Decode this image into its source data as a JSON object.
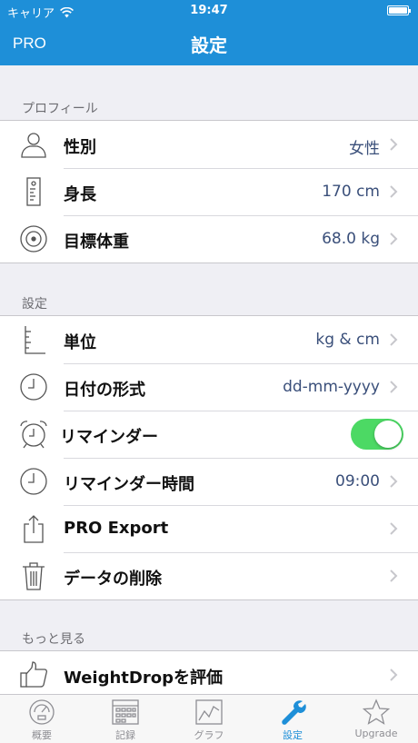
{
  "status_bar": {
    "carrier": "キャリア",
    "time": "19:47"
  },
  "nav": {
    "left_button": "PRO",
    "title": "設定"
  },
  "sections": [
    {
      "header": "プロフィール",
      "rows": [
        {
          "icon": "person-icon",
          "label": "性別",
          "value": "女性"
        },
        {
          "icon": "height-icon",
          "label": "身長",
          "value": "170 cm"
        },
        {
          "icon": "target-icon",
          "label": "目標体重",
          "value": "68.0 kg"
        }
      ]
    },
    {
      "header": "設定",
      "rows": [
        {
          "icon": "ruler-icon",
          "label": "単位",
          "value": "kg & cm"
        },
        {
          "icon": "clock-icon",
          "label": "日付の形式",
          "value": "dd-mm-yyyy"
        },
        {
          "icon": "alarm-clock-icon",
          "label": "リマインダー",
          "toggle_on": true
        },
        {
          "icon": "clock-icon",
          "label": "リマインダー時間",
          "value": "09:00"
        },
        {
          "icon": "share-icon",
          "label": "PRO Export",
          "value": ""
        },
        {
          "icon": "trash-icon",
          "label": "データの削除",
          "value": ""
        }
      ]
    },
    {
      "header": "もっと見る",
      "rows": [
        {
          "icon": "thumbs-up-icon",
          "label": "WeightDropを評価",
          "value": ""
        }
      ]
    }
  ],
  "tabs": [
    {
      "icon": "gauge-icon",
      "label": "概要",
      "active": false
    },
    {
      "icon": "calendar-icon",
      "label": "記録",
      "active": false
    },
    {
      "icon": "graph-icon",
      "label": "グラフ",
      "active": false
    },
    {
      "icon": "wrench-icon",
      "label": "設定",
      "active": true
    },
    {
      "icon": "star-icon",
      "label": "Upgrade",
      "active": false
    }
  ],
  "colors": {
    "accent": "#1e8fd8",
    "toggle_on": "#4cd964",
    "value_text": "#3a4f7a",
    "background": "#efeff4"
  }
}
